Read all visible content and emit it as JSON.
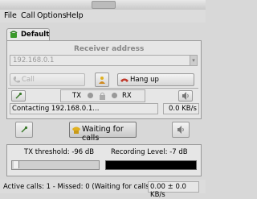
{
  "menu": {
    "file": "File",
    "call": "Call",
    "options": "Options",
    "help": "Help"
  },
  "tab": {
    "label": "Default",
    "icon": "phone-icon"
  },
  "receiver": {
    "title": "Receiver address",
    "value": "192.168.0.1"
  },
  "buttons": {
    "call": "Call",
    "hang_up": "Hang up",
    "waiting": "Waiting for calls"
  },
  "indicators": {
    "tx": "TX",
    "rx": "RX"
  },
  "connection": {
    "status": "Contacting 192.168.0.1...",
    "rate": "0.0 KB/s"
  },
  "tx_threshold": {
    "label": "TX threshold: -96 dB"
  },
  "recording": {
    "label": "Recording Level: -7 dB"
  },
  "statusbar": {
    "text": "Active calls: 1 - Missed: 0 (Waiting for calls)",
    "rate": "0.00 ± 0.0 KB/s"
  },
  "colors": {
    "hangup_icon": "#c0392b",
    "phone_icon": "#3b9a2b",
    "waiting_icon": "#e0b020"
  }
}
